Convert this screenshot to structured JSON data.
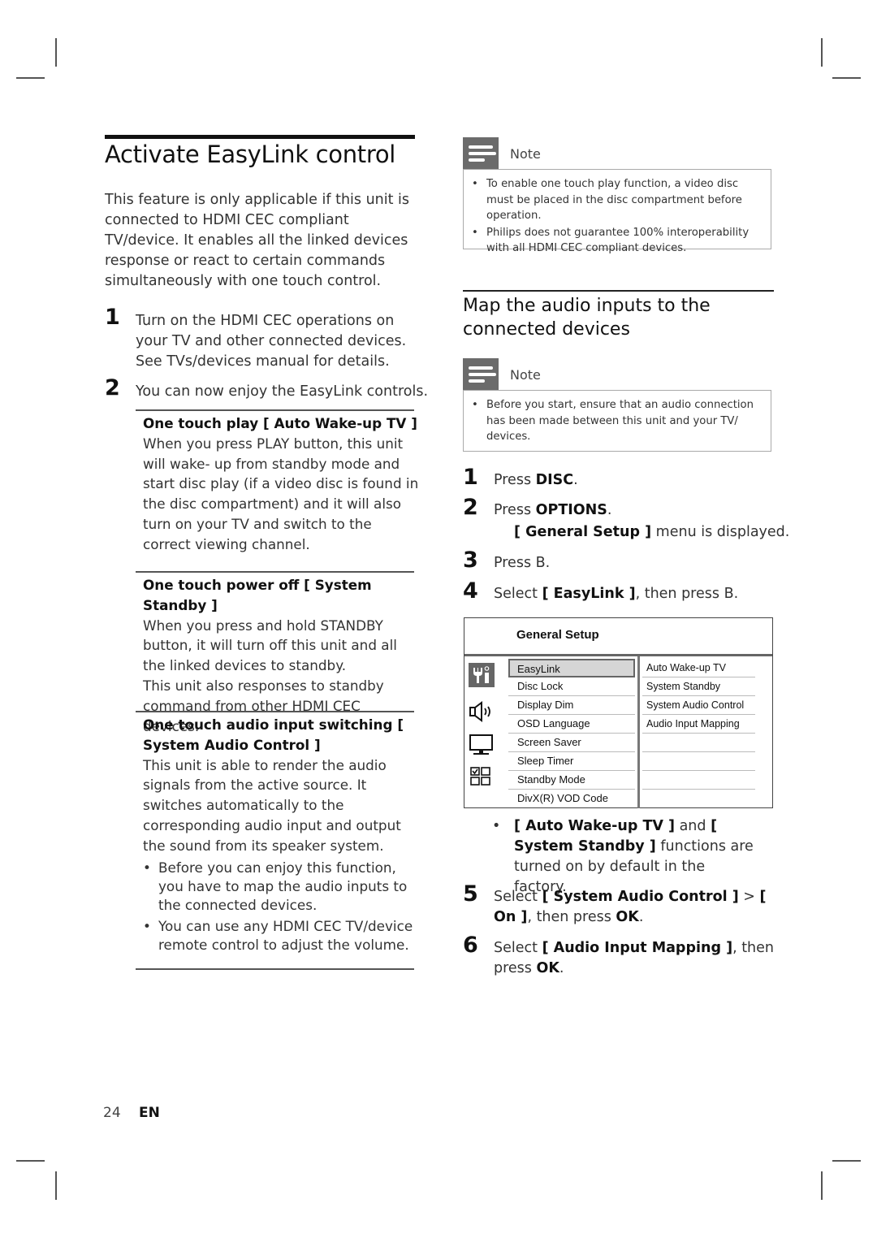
{
  "left": {
    "title": "Activate EasyLink control",
    "intro": "This feature is only applicable if this unit is connected to HDMI CEC compliant TV/device. It enables all the linked devices response or react to certain commands simultaneously with one touch control.",
    "steps": [
      {
        "num": "1",
        "text": "Turn on the HDMI CEC operations on your TV and other connected devices. See TVs/devices manual for details."
      },
      {
        "num": "2",
        "text": "You can now enjoy the EasyLink controls."
      }
    ],
    "sections": [
      {
        "title": "One touch play [ Auto Wake-up TV ]",
        "body": "When you press PLAY button, this unit will wake- up from standby mode and start disc play (if a video disc is found in the disc compartment) and it will also turn on your TV and switch to the correct viewing channel."
      },
      {
        "title": "One touch power off [ System Standby ]",
        "body": "When you press and hold STANDBY button, it will turn off this unit and all the linked devices to standby.",
        "body2": "This unit also responses to standby command from other HDMI CEC devices."
      },
      {
        "title": "One touch audio input switching [ System Audio Control ]",
        "body": "This unit is able to render the audio signals from the active source.  It switches automatically to the corresponding audio input and output the sound from its speaker system.",
        "bullets": [
          "Before you can enjoy this function, you have to map the audio inputs to the connected devices.",
          "You can use any HDMI CEC TV/device remote control to adjust the volume."
        ]
      }
    ]
  },
  "right": {
    "note1": {
      "label": "Note",
      "icon": "note-icon",
      "bullets": [
        "To enable one touch play function, a video disc must be placed in the disc compartment before operation.",
        "Philips does not guarantee 100% interoperability with all HDMI CEC compliant devices."
      ]
    },
    "heading": "Map the audio inputs to the connected devices",
    "note2": {
      "label": "Note",
      "icon": "note-icon",
      "bullets": [
        "Before you start, ensure that an audio connection has been made between this unit and your TV/ devices."
      ]
    },
    "steps": [
      {
        "num": "1",
        "pre": "Press ",
        "bold": "DISC",
        "post": "."
      },
      {
        "num": "2",
        "pre": "Press ",
        "bold": "OPTIONS",
        "post": ".",
        "sub_bold": "[ General Setup ]",
        "sub_post": " menu is displayed."
      },
      {
        "num": "3",
        "pre": "Press ",
        "bold": "B",
        "post": "."
      },
      {
        "num": "4",
        "pre": "Select ",
        "bold": "[ EasyLink ]",
        "post": ", then press ",
        "bold2": "B",
        "post2": "."
      }
    ],
    "menu": {
      "title": "General Setup",
      "icons": [
        "settings-tools-icon",
        "speaker-icon",
        "monitor-icon",
        "preferences-grid-icon"
      ],
      "left_items": [
        "EasyLink",
        "Disc Lock",
        "Display Dim",
        "OSD Language",
        "Screen Saver",
        "Sleep Timer",
        "Standby Mode",
        "DivX(R) VOD Code"
      ],
      "selected": "EasyLink",
      "right_items": [
        "Auto Wake-up TV",
        "System Standby",
        "System Audio Control",
        "Audio Input Mapping",
        "",
        "",
        ""
      ]
    },
    "bullet": {
      "b1": "[ Auto Wake-up TV ]",
      "t1": " and ",
      "b2": "[ System Standby ]",
      "t2": " functions are turned on by default in the factory."
    },
    "steps2": [
      {
        "num": "5",
        "pre": "Select ",
        "bold": "[ System Audio Control ]",
        "mid": " > ",
        "bold2": "[ On ]",
        "post": ", then press ",
        "bold3": "OK",
        "post2": "."
      },
      {
        "num": "6",
        "pre": "Select ",
        "bold": "[ Audio Input Mapping ]",
        "post": ", then press ",
        "bold2": "OK",
        "post2": "."
      }
    ]
  },
  "footer": {
    "page": "24",
    "lang": "EN"
  }
}
